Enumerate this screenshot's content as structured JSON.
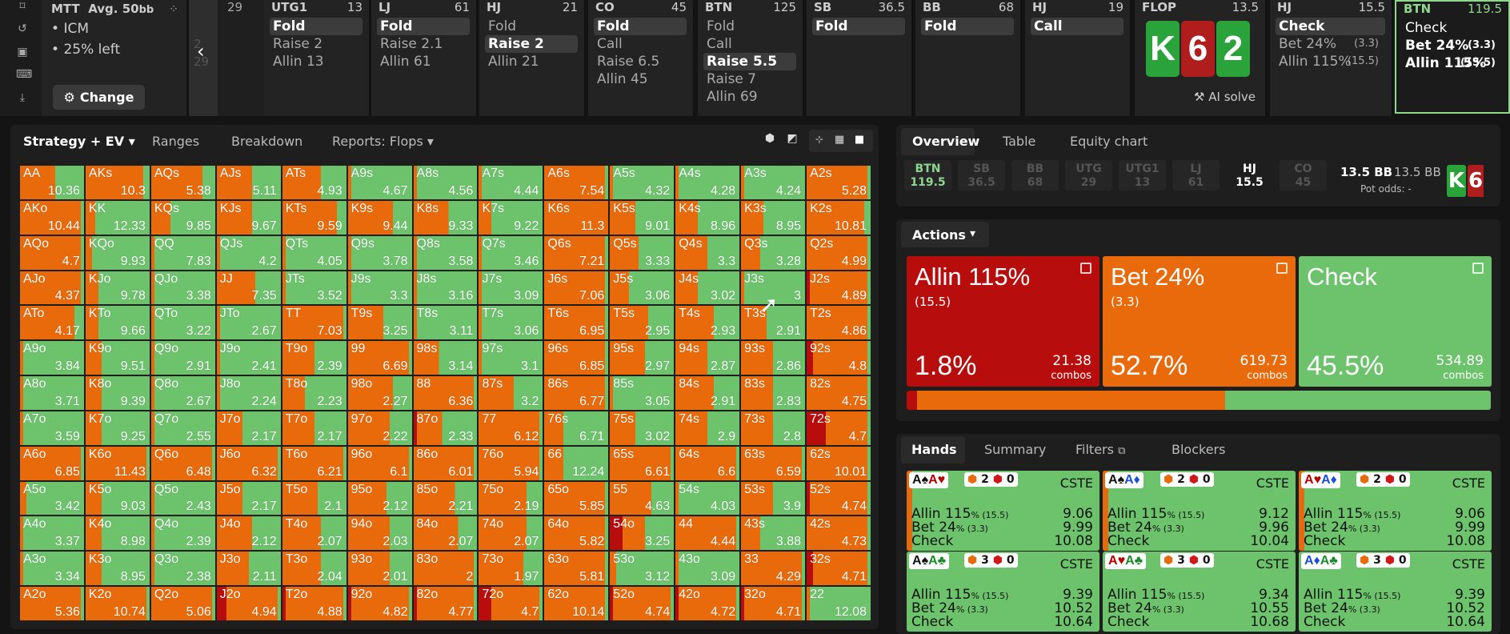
{
  "left_icons": [
    "bookmark-icon",
    "history-icon",
    "save-icon",
    "gamepad-icon",
    "export-icon"
  ],
  "mtt": {
    "title": "MTT",
    "avg": "Avg. 50",
    "avg_unit": "bb",
    "line1": "ICM",
    "line2": "25% left",
    "change_label": "Change"
  },
  "prev_col": {
    "stack": "29",
    "val1": "2",
    "val2": "29"
  },
  "positions": [
    {
      "pos": "UTG1",
      "stack": "13",
      "actions": [
        {
          "label": "Fold",
          "sel": true
        },
        {
          "label": "Raise 2"
        },
        {
          "label": "Allin 13"
        }
      ]
    },
    {
      "pos": "LJ",
      "stack": "61",
      "actions": [
        {
          "label": "Fold",
          "sel": true
        },
        {
          "label": "Raise 2.1"
        },
        {
          "label": "Allin 61"
        }
      ]
    },
    {
      "pos": "HJ",
      "stack": "21",
      "actions": [
        {
          "label": "Fold"
        },
        {
          "label": "Raise 2",
          "sel": true
        },
        {
          "label": "Allin 21"
        }
      ]
    },
    {
      "pos": "CO",
      "stack": "45",
      "actions": [
        {
          "label": "Fold",
          "sel": true
        },
        {
          "label": "Call"
        },
        {
          "label": "Raise 6.5"
        },
        {
          "label": "Allin 45"
        }
      ]
    },
    {
      "pos": "BTN",
      "stack": "125",
      "actions": [
        {
          "label": "Fold"
        },
        {
          "label": "Call"
        },
        {
          "label": "Raise 5.5",
          "sel": true
        },
        {
          "label": "Raise 7"
        },
        {
          "label": "Allin 69"
        }
      ]
    },
    {
      "pos": "SB",
      "stack": "36.5",
      "actions": [
        {
          "label": "Fold",
          "sel": true
        }
      ]
    },
    {
      "pos": "BB",
      "stack": "68",
      "actions": [
        {
          "label": "Fold",
          "sel": true
        }
      ]
    },
    {
      "pos": "HJ",
      "stack": "19",
      "actions": [
        {
          "label": "Call",
          "sel": true
        }
      ]
    }
  ],
  "flop": {
    "label": "FLOP",
    "pot": "13.5",
    "cards": [
      "K",
      "6",
      "2"
    ],
    "ai_solve": "AI solve"
  },
  "hj_col": {
    "pos": "HJ",
    "stack": "15.5",
    "actions": [
      {
        "label": "Check",
        "sel": true
      },
      {
        "label": "Bet 24%",
        "size": "(3.3)"
      },
      {
        "label": "Allin 115%",
        "size": "(15.5)"
      }
    ]
  },
  "btn_col": {
    "pos": "BTN",
    "stack": "119.5",
    "actions": [
      {
        "label": "Check"
      },
      {
        "label": "Bet 24%",
        "size": "(3.3)"
      },
      {
        "label": "Allin 115%",
        "size": "(15.5)"
      }
    ]
  },
  "grid_tabs": {
    "strategy": "Strategy + EV",
    "ranges": "Ranges",
    "breakdown": "Breakdown",
    "reports": "Reports: Flops"
  },
  "colors": {
    "allin": "#b80d0d",
    "bet": "#e86a0b",
    "check": "#6cc36c"
  },
  "grid": [
    [
      [
        "AA",
        0,
        0.55,
        10.36
      ],
      [
        "AKs",
        0,
        0.9,
        10.3
      ],
      [
        "AQs",
        0,
        0.8,
        5.38
      ],
      [
        "AJs",
        0,
        0.55,
        5.11
      ],
      [
        "ATs",
        0,
        0.6,
        4.93
      ],
      [
        "A9s",
        0,
        0.05,
        4.67
      ],
      [
        "A8s",
        0,
        0.05,
        4.56
      ],
      [
        "A7s",
        0,
        0.05,
        4.44
      ],
      [
        "A6s",
        0,
        0.95,
        7.54
      ],
      [
        "A5s",
        0,
        0.05,
        4.32
      ],
      [
        "A4s",
        0,
        0.05,
        4.28
      ],
      [
        "A3s",
        0,
        0.05,
        4.24
      ],
      [
        "A2s",
        0,
        0.95,
        5.28
      ]
    ],
    [
      [
        "AKo",
        0,
        0.95,
        10.44
      ],
      [
        "KK",
        0,
        0.15,
        12.33
      ],
      [
        "KQs",
        0,
        0.3,
        9.85
      ],
      [
        "KJs",
        0,
        0.55,
        9.67
      ],
      [
        "KTs",
        0,
        0.85,
        9.59
      ],
      [
        "K9s",
        0,
        0.7,
        9.44
      ],
      [
        "K8s",
        0,
        0.55,
        9.33
      ],
      [
        "K7s",
        0,
        0.2,
        9.22
      ],
      [
        "K6s",
        0,
        1,
        11.3
      ],
      [
        "K5s",
        0,
        0.4,
        9.01
      ],
      [
        "K4s",
        0,
        0.35,
        8.96
      ],
      [
        "K3s",
        0,
        0.35,
        8.95
      ],
      [
        "K2s",
        0,
        0.9,
        10.81
      ]
    ],
    [
      [
        "AQo",
        0,
        0.95,
        4.7
      ],
      [
        "KQo",
        0,
        0.1,
        9.93
      ],
      [
        "QQ",
        0,
        0.05,
        7.83
      ],
      [
        "QJs",
        0,
        0.05,
        4.2
      ],
      [
        "QTs",
        0,
        0.05,
        4.05
      ],
      [
        "Q9s",
        0,
        0.05,
        3.78
      ],
      [
        "Q8s",
        0,
        0.05,
        3.58
      ],
      [
        "Q7s",
        0,
        0.05,
        3.46
      ],
      [
        "Q6s",
        0,
        0.95,
        7.21
      ],
      [
        "Q5s",
        0,
        0.45,
        3.33
      ],
      [
        "Q4s",
        0,
        0.5,
        3.3
      ],
      [
        "Q3s",
        0,
        0.3,
        3.28
      ],
      [
        "Q2s",
        0,
        0.95,
        4.99
      ]
    ],
    [
      [
        "AJo",
        0,
        0.95,
        4.37
      ],
      [
        "KJo",
        0,
        0.2,
        9.78
      ],
      [
        "QJo",
        0,
        0.05,
        3.38
      ],
      [
        "JJ",
        0,
        0.6,
        7.35
      ],
      [
        "JTs",
        0,
        0.05,
        3.52
      ],
      [
        "J9s",
        0,
        0.05,
        3.3
      ],
      [
        "J8s",
        0,
        0.05,
        3.16
      ],
      [
        "J7s",
        0,
        0.05,
        3.09
      ],
      [
        "J6s",
        0,
        0.95,
        7.06
      ],
      [
        "J5s",
        0,
        0.3,
        3.06
      ],
      [
        "J4s",
        0,
        0.35,
        3.02
      ],
      [
        "J3s",
        0,
        0.05,
        3
      ],
      [
        "J2s",
        0.05,
        0.95,
        4.89
      ]
    ],
    [
      [
        "ATo",
        0,
        0.85,
        4.17
      ],
      [
        "KTo",
        0,
        0.2,
        9.66
      ],
      [
        "QTo",
        0,
        0.05,
        3.22
      ],
      [
        "JTo",
        0,
        0.05,
        2.67
      ],
      [
        "TT",
        0,
        0.95,
        7.03
      ],
      [
        "T9s",
        0,
        0.55,
        3.25
      ],
      [
        "T8s",
        0,
        0.05,
        3.11
      ],
      [
        "T7s",
        0,
        0.05,
        3.06
      ],
      [
        "T6s",
        0,
        0.95,
        6.95
      ],
      [
        "T5s",
        0,
        0.6,
        2.95
      ],
      [
        "T4s",
        0,
        0.6,
        2.93
      ],
      [
        "T3s",
        0,
        0.4,
        2.91
      ],
      [
        "T2s",
        0,
        0.95,
        4.86
      ]
    ],
    [
      [
        "A9o",
        0,
        0.05,
        3.84
      ],
      [
        "K9o",
        0,
        0.25,
        9.51
      ],
      [
        "Q9o",
        0,
        0.05,
        2.91
      ],
      [
        "J9o",
        0,
        0.05,
        2.41
      ],
      [
        "T9o",
        0,
        0.5,
        2.39
      ],
      [
        "99",
        0,
        0.95,
        6.69
      ],
      [
        "98s",
        0,
        0.4,
        3.14
      ],
      [
        "97s",
        0,
        0.05,
        3.1
      ],
      [
        "96s",
        0,
        0.95,
        6.85
      ],
      [
        "95s",
        0,
        0.55,
        2.97
      ],
      [
        "94s",
        0,
        0.5,
        2.87
      ],
      [
        "93s",
        0,
        0.5,
        2.86
      ],
      [
        "92s",
        0.1,
        0.95,
        4.8
      ]
    ],
    [
      [
        "A8o",
        0,
        0.05,
        3.71
      ],
      [
        "K8o",
        0,
        0.25,
        9.39
      ],
      [
        "Q8o",
        0,
        0.05,
        2.67
      ],
      [
        "J8o",
        0,
        0.05,
        2.24
      ],
      [
        "T8o",
        0,
        0.35,
        2.23
      ],
      [
        "98o",
        0,
        0.7,
        2.27
      ],
      [
        "88",
        0,
        0.95,
        6.36
      ],
      [
        "87s",
        0,
        0.55,
        3.2
      ],
      [
        "86s",
        0,
        0.95,
        6.77
      ],
      [
        "85s",
        0,
        0.05,
        3.05
      ],
      [
        "84s",
        0,
        0.6,
        2.91
      ],
      [
        "83s",
        0,
        0.5,
        2.83
      ],
      [
        "82s",
        0,
        0.95,
        4.75
      ]
    ],
    [
      [
        "A7o",
        0,
        0.05,
        3.59
      ],
      [
        "K7o",
        0,
        0.25,
        9.25
      ],
      [
        "Q7o",
        0,
        0.05,
        2.55
      ],
      [
        "J7o",
        0,
        0.4,
        2.17
      ],
      [
        "T7o",
        0,
        0.5,
        2.17
      ],
      [
        "97o",
        0,
        0.65,
        2.22
      ],
      [
        "87o",
        0.05,
        0.45,
        2.33
      ],
      [
        "77",
        0,
        0.95,
        6.12
      ],
      [
        "76s",
        0,
        0.3,
        6.71
      ],
      [
        "75s",
        0,
        0.4,
        3.02
      ],
      [
        "74s",
        0,
        0.5,
        2.9
      ],
      [
        "73s",
        0,
        0.5,
        2.8
      ],
      [
        "72s",
        0.3,
        0.95,
        4.7
      ]
    ],
    [
      [
        "A6o",
        0,
        0.95,
        6.85
      ],
      [
        "K6o",
        0,
        0.95,
        11.43
      ],
      [
        "Q6o",
        0,
        0.95,
        6.48
      ],
      [
        "J6o",
        0,
        0.95,
        6.32
      ],
      [
        "T6o",
        0,
        0.95,
        6.21
      ],
      [
        "96o",
        0,
        0.95,
        6.1
      ],
      [
        "86o",
        0,
        0.95,
        6.01
      ],
      [
        "76o",
        0,
        0.95,
        5.94
      ],
      [
        "66",
        0,
        0.3,
        12.24
      ],
      [
        "65s",
        0,
        0.95,
        6.61
      ],
      [
        "64s",
        0,
        0.95,
        6.6
      ],
      [
        "63s",
        0,
        0.95,
        6.59
      ],
      [
        "62s",
        0,
        0.95,
        10.01
      ]
    ],
    [
      [
        "A5o",
        0,
        0.1,
        3.42
      ],
      [
        "K5o",
        0,
        0.25,
        9.03
      ],
      [
        "Q5o",
        0,
        0.05,
        2.43
      ],
      [
        "J5o",
        0,
        0.4,
        2.17
      ],
      [
        "T5o",
        0,
        0.55,
        2.1
      ],
      [
        "95o",
        0,
        0.6,
        2.12
      ],
      [
        "85o",
        0,
        0.65,
        2.21
      ],
      [
        "75o",
        0,
        0.75,
        2.19
      ],
      [
        "65o",
        0,
        0.95,
        5.85
      ],
      [
        "55",
        0,
        0.65,
        4.63
      ],
      [
        "54s",
        0,
        0.05,
        4.03
      ],
      [
        "53s",
        0,
        0.5,
        3.9
      ],
      [
        "52s",
        0.05,
        0.95,
        4.74
      ]
    ],
    [
      [
        "A4o",
        0,
        0.05,
        3.37
      ],
      [
        "K4o",
        0,
        0.25,
        8.98
      ],
      [
        "Q4o",
        0,
        0.05,
        2.39
      ],
      [
        "J4o",
        0,
        0.55,
        2.12
      ],
      [
        "T4o",
        0,
        0.6,
        2.07
      ],
      [
        "94o",
        0,
        0.65,
        2.03
      ],
      [
        "84o",
        0,
        0.7,
        2.07
      ],
      [
        "74o",
        0,
        0.75,
        2.07
      ],
      [
        "64o",
        0,
        0.95,
        5.82
      ],
      [
        "54o",
        0.2,
        0.55,
        3.25
      ],
      [
        "44",
        0,
        0.95,
        4.44
      ],
      [
        "43s",
        0,
        0.3,
        3.88
      ],
      [
        "42s",
        0,
        0.95,
        4.73
      ]
    ],
    [
      [
        "A3o",
        0,
        0.05,
        3.34
      ],
      [
        "K3o",
        0,
        0.25,
        8.95
      ],
      [
        "Q3o",
        0,
        0.05,
        2.38
      ],
      [
        "J3o",
        0,
        0.5,
        2.11
      ],
      [
        "T3o",
        0,
        0.6,
        2.04
      ],
      [
        "93o",
        0,
        0.65,
        2.01
      ],
      [
        "83o",
        0,
        0.95,
        2
      ],
      [
        "73o",
        0,
        0.7,
        1.97
      ],
      [
        "63o",
        0,
        0.95,
        5.81
      ],
      [
        "53o",
        0,
        0.1,
        3.12
      ],
      [
        "43o",
        0,
        0.05,
        3.09
      ],
      [
        "33",
        0,
        0.95,
        4.29
      ],
      [
        "32s",
        0.1,
        0.95,
        4.71
      ]
    ],
    [
      [
        "A2o",
        0,
        0.95,
        5.36
      ],
      [
        "K2o",
        0,
        0.95,
        10.74
      ],
      [
        "Q2o",
        0,
        0.95,
        5.06
      ],
      [
        "J2o",
        0.15,
        0.95,
        4.94
      ],
      [
        "T2o",
        0.05,
        0.95,
        4.88
      ],
      [
        "92o",
        0.05,
        0.95,
        4.82
      ],
      [
        "82o",
        0.05,
        0.95,
        4.77
      ],
      [
        "72o",
        0.2,
        0.95,
        4.7
      ],
      [
        "62o",
        0,
        0.95,
        10.14
      ],
      [
        "52o",
        0.05,
        0.95,
        4.74
      ],
      [
        "42o",
        0.05,
        0.95,
        4.72
      ],
      [
        "32o",
        0.05,
        0.95,
        4.71
      ],
      [
        "22",
        0,
        0.05,
        12.08
      ]
    ]
  ],
  "right_tabs": {
    "overview": "Overview",
    "table": "Table",
    "equity": "Equity chart"
  },
  "pos_chips": [
    {
      "pos": "BTN",
      "stack": "119.5",
      "state": "btn"
    },
    {
      "pos": "SB",
      "stack": "36.5",
      "state": "off"
    },
    {
      "pos": "BB",
      "stack": "68",
      "state": "off"
    },
    {
      "pos": "UTG",
      "stack": "29",
      "state": "off"
    },
    {
      "pos": "UTG1",
      "stack": "13",
      "state": "off"
    },
    {
      "pos": "LJ",
      "stack": "61",
      "state": "off"
    },
    {
      "pos": "HJ",
      "stack": "15.5",
      "state": "hi"
    },
    {
      "pos": "CO",
      "stack": "45",
      "state": "off"
    }
  ],
  "pot": {
    "left": "13.5 BB",
    "right": "13.5 BB",
    "odds_label": "Pot odds:",
    "odds_value": "-"
  },
  "actions_header": "Actions",
  "actions": [
    {
      "name": "Allin 115%",
      "size": "(15.5)",
      "pct": "1.8%",
      "combos": "21.38",
      "combos_label": "combos",
      "color": "#b80d0d",
      "share": 0.018
    },
    {
      "name": "Bet 24%",
      "size": "(3.3)",
      "pct": "52.7%",
      "combos": "619.73",
      "combos_label": "combos",
      "color": "#e86a0b",
      "share": 0.527
    },
    {
      "name": "Check",
      "size": "",
      "pct": "45.5%",
      "combos": "534.89",
      "combos_label": "combos",
      "color": "#6cc36c",
      "share": 0.455
    }
  ],
  "hands_tabs": {
    "hands": "Hands",
    "summary": "Summary",
    "filters": "Filters",
    "blockers": "Blockers"
  },
  "hands": [
    {
      "c1": "A",
      "s1": "♠",
      "k1": "#111",
      "c2": "A",
      "s2": "♥",
      "k2": "#b50000",
      "b1": "2",
      "b2": "0",
      "tag": "CSTE",
      "allin": "9.06",
      "bet": "9.99",
      "check": "10.08",
      "stripe": 0.03
    },
    {
      "c1": "A",
      "s1": "♠",
      "k1": "#111",
      "c2": "A",
      "s2": "♦",
      "k2": "#1b4fd3",
      "b1": "2",
      "b2": "0",
      "tag": "CSTE",
      "allin": "9.12",
      "bet": "9.96",
      "check": "10.04",
      "stripe": 0.03
    },
    {
      "c1": "A",
      "s1": "♥",
      "k1": "#b50000",
      "c2": "A",
      "s2": "♦",
      "k2": "#1b4fd3",
      "b1": "2",
      "b2": "0",
      "tag": "CSTE",
      "allin": "9.06",
      "bet": "9.99",
      "check": "10.08",
      "stripe": 0.03
    },
    {
      "c1": "A",
      "s1": "♠",
      "k1": "#111",
      "c2": "A",
      "s2": "♣",
      "k2": "#1a8a2a",
      "b1": "3",
      "b2": "0",
      "tag": "CSTE",
      "allin": "9.39",
      "bet": "10.52",
      "check": "10.64",
      "stripe": 0
    },
    {
      "c1": "A",
      "s1": "♥",
      "k1": "#b50000",
      "c2": "A",
      "s2": "♣",
      "k2": "#1a8a2a",
      "b1": "3",
      "b2": "0",
      "tag": "CSTE",
      "allin": "9.34",
      "bet": "10.55",
      "check": "10.68",
      "stripe": 0
    },
    {
      "c1": "A",
      "s1": "♦",
      "k1": "#1b4fd3",
      "c2": "A",
      "s2": "♣",
      "k2": "#1a8a2a",
      "b1": "3",
      "b2": "0",
      "tag": "CSTE",
      "allin": "9.39",
      "bet": "10.52",
      "check": "10.64",
      "stripe": 0
    }
  ],
  "hand_rows": {
    "allin": "Allin 115",
    "allin_size": "% (15.5)",
    "bet": "Bet 24",
    "bet_size": "% (3.3)",
    "check": "Check"
  }
}
